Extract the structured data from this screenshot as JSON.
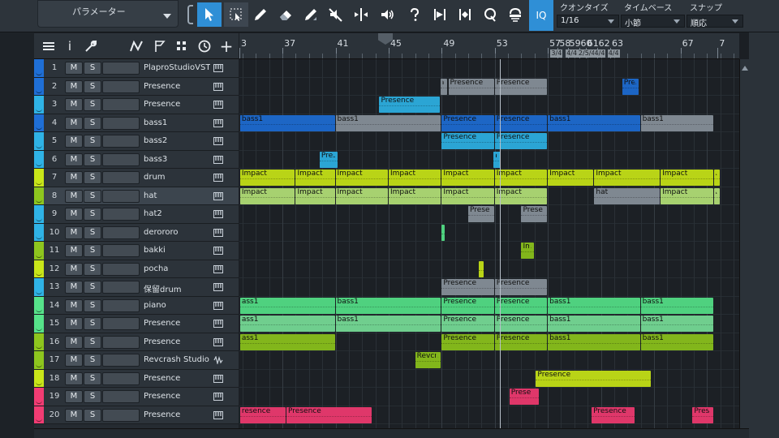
{
  "parameter_panel": {
    "label": "パラメーター"
  },
  "toolbar": {
    "iq_label": "IQ",
    "quantize": {
      "label": "クオンタイズ",
      "value": "1/16"
    },
    "timebase": {
      "label": "タイムベース",
      "value": "小節"
    },
    "snap": {
      "label": "スナップ",
      "value": "順応"
    },
    "tools": [
      "arrow-tool-icon",
      "range-tool-icon",
      "pencil-tool-icon",
      "eraser-tool-icon",
      "paint-tool-icon",
      "mute-tool-icon",
      "split-tool-icon",
      "listen-tool-icon",
      "help-icon",
      "transient-icon",
      "bend-icon",
      "quantize-q-icon",
      "groove-icon"
    ]
  },
  "track_tools": {
    "info_label": "i",
    "add_label": "+"
  },
  "button_labels": {
    "mute": "M",
    "solo": "S"
  },
  "ruler": {
    "bars": [
      "3",
      "37",
      "41",
      "45",
      "49",
      "53",
      "57",
      "58",
      "59",
      "60",
      "61",
      "62",
      "63",
      "67",
      "7"
    ],
    "time_signatures": [
      "3/4",
      "4/4",
      "2/5/4",
      "4/4",
      "4/4"
    ]
  },
  "colors": {
    "blue": "#1f6fd6",
    "cyan": "#2fb3e6",
    "lime": "#c9e619",
    "green": "#56e38a",
    "pink": "#f23c73",
    "gray": "#8a949e",
    "olive": "#8ec61e"
  },
  "tracks": [
    {
      "num": "1",
      "name": "PlaproStudioVSTi",
      "color": "#1f6fd6",
      "type": "instrument"
    },
    {
      "num": "2",
      "name": "Presence",
      "color": "#1f6fd6",
      "type": "instrument"
    },
    {
      "num": "3",
      "name": "Presence",
      "color": "#2fb3e6",
      "type": "instrument"
    },
    {
      "num": "4",
      "name": "bass1",
      "color": "#1f6fd6",
      "type": "instrument"
    },
    {
      "num": "5",
      "name": "bass2",
      "color": "#2fb3e6",
      "type": "instrument"
    },
    {
      "num": "6",
      "name": "bass3",
      "color": "#2fb3e6",
      "type": "instrument"
    },
    {
      "num": "7",
      "name": "drum",
      "color": "#c9e619",
      "type": "instrument"
    },
    {
      "num": "8",
      "name": "hat",
      "color": "#8ec61e",
      "type": "instrument",
      "selected": true
    },
    {
      "num": "9",
      "name": "hat2",
      "color": "#2fb3e6",
      "type": "instrument"
    },
    {
      "num": "10",
      "name": "derororo",
      "color": "#2fb3e6",
      "type": "instrument"
    },
    {
      "num": "11",
      "name": " bakki",
      "color": "#8ec61e",
      "type": "instrument"
    },
    {
      "num": "12",
      "name": "pocha",
      "color": "#c9e619",
      "type": "instrument"
    },
    {
      "num": "13",
      "name": "保留drum",
      "color": "#2fb3e6",
      "type": "instrument"
    },
    {
      "num": "14",
      "name": "piano",
      "color": "#56e38a",
      "type": "instrument"
    },
    {
      "num": "15",
      "name": "Presence",
      "color": "#56e38a",
      "type": "instrument"
    },
    {
      "num": "16",
      "name": "Presence",
      "color": "#8ec61e",
      "type": "instrument"
    },
    {
      "num": "17",
      "name": "Revcrash Studio",
      "color": "#8ec61e",
      "type": "audio"
    },
    {
      "num": "18",
      "name": "Presence",
      "color": "#c9e619",
      "type": "instrument"
    },
    {
      "num": "19",
      "name": "Presence",
      "color": "#f23c73",
      "type": "instrument"
    },
    {
      "num": "20",
      "name": "Presence",
      "color": "#f23c73",
      "type": "instrument"
    }
  ],
  "events": [
    {
      "track": 2,
      "start": 48.9,
      "end": 49.5,
      "label": "Pr",
      "color": "#8a949e"
    },
    {
      "track": 2,
      "start": 49.5,
      "end": 53,
      "label": "Presence",
      "color": "#8a949e"
    },
    {
      "track": 2,
      "start": 53,
      "end": 57,
      "label": "Presence",
      "color": "#8a949e"
    },
    {
      "track": 2,
      "start": 62.6,
      "end": 63.9,
      "label": "Pres",
      "color": "#1f6fd6"
    },
    {
      "track": 3,
      "start": 44.3,
      "end": 48.9,
      "label": "Presence",
      "color": "#2fb3e6"
    },
    {
      "track": 4,
      "start": 33.8,
      "end": 41,
      "label": "bass1",
      "color": "#1f6fd6"
    },
    {
      "track": 4,
      "start": 41,
      "end": 49,
      "label": "bass1",
      "color": "#8a949e"
    },
    {
      "track": 4,
      "start": 49,
      "end": 53,
      "label": "Presence",
      "color": "#1f6fd6"
    },
    {
      "track": 4,
      "start": 53,
      "end": 57,
      "label": "Presence",
      "color": "#1f6fd6"
    },
    {
      "track": 4,
      "start": 57,
      "end": 64,
      "label": "bass1",
      "color": "#1f6fd6"
    },
    {
      "track": 4,
      "start": 64,
      "end": 69.5,
      "label": "bass1",
      "color": "#8a949e"
    },
    {
      "track": 5,
      "start": 49,
      "end": 53,
      "label": "Presence",
      "color": "#2fb3e6"
    },
    {
      "track": 5,
      "start": 53,
      "end": 57,
      "label": "Presence",
      "color": "#2fb3e6"
    },
    {
      "track": 6,
      "start": 39.8,
      "end": 41.2,
      "label": "Pres",
      "color": "#2fb3e6"
    },
    {
      "track": 6,
      "start": 52.9,
      "end": 53.5,
      "label": "Pres",
      "color": "#2fb3e6"
    },
    {
      "track": 7,
      "start": 33.8,
      "end": 38,
      "label": "Impact",
      "color": "#c9e619"
    },
    {
      "track": 7,
      "start": 38,
      "end": 41,
      "label": "Impact",
      "color": "#c9e619"
    },
    {
      "track": 7,
      "start": 41,
      "end": 45,
      "label": "Impact",
      "color": "#c9e619"
    },
    {
      "track": 7,
      "start": 45,
      "end": 49,
      "label": "Impact",
      "color": "#c9e619"
    },
    {
      "track": 7,
      "start": 49,
      "end": 53,
      "label": "Impact",
      "color": "#c9e619"
    },
    {
      "track": 7,
      "start": 53,
      "end": 57,
      "label": "Impact",
      "color": "#c9e619"
    },
    {
      "track": 7,
      "start": 57,
      "end": 60.5,
      "label": "Impact",
      "color": "#c9e619"
    },
    {
      "track": 7,
      "start": 60.5,
      "end": 65.5,
      "label": "Impact",
      "color": "#c9e619"
    },
    {
      "track": 7,
      "start": 65.5,
      "end": 69.5,
      "label": "Impact",
      "color": "#c9e619"
    },
    {
      "track": 7,
      "start": 69.5,
      "end": 70,
      "label": "Im",
      "color": "#c9e619"
    },
    {
      "track": 8,
      "start": 33.8,
      "end": 38,
      "label": "Impact",
      "color": "#b5e37a"
    },
    {
      "track": 8,
      "start": 38,
      "end": 41,
      "label": "Impact",
      "color": "#b5e37a"
    },
    {
      "track": 8,
      "start": 41,
      "end": 45,
      "label": "Impact",
      "color": "#b5e37a"
    },
    {
      "track": 8,
      "start": 45,
      "end": 49,
      "label": "Impact",
      "color": "#b5e37a"
    },
    {
      "track": 8,
      "start": 49,
      "end": 53,
      "label": "Impact",
      "color": "#b5e37a"
    },
    {
      "track": 8,
      "start": 53,
      "end": 57,
      "label": "Impact",
      "color": "#b5e37a"
    },
    {
      "track": 8,
      "start": 60.5,
      "end": 65.5,
      "label": "hat",
      "color": "#8a949e"
    },
    {
      "track": 8,
      "start": 65.5,
      "end": 69.5,
      "label": "Impact",
      "color": "#b5e37a"
    },
    {
      "track": 8,
      "start": 69.5,
      "end": 70,
      "label": "Im",
      "color": "#b5e37a"
    },
    {
      "track": 9,
      "start": 51,
      "end": 53,
      "label": "Prese",
      "color": "#8a949e"
    },
    {
      "track": 9,
      "start": 55,
      "end": 57,
      "label": "Prese",
      "color": "#8a949e"
    },
    {
      "track": 10,
      "start": 49,
      "end": 49.3,
      "label": "",
      "color": "#56e38a"
    },
    {
      "track": 11,
      "start": 55,
      "end": 56,
      "label": "Im",
      "color": "#8ec61e"
    },
    {
      "track": 12,
      "start": 51.8,
      "end": 52.2,
      "label": "",
      "color": "#c9e619"
    },
    {
      "track": 13,
      "start": 49,
      "end": 53,
      "label": "Presence",
      "color": "#8a949e"
    },
    {
      "track": 13,
      "start": 53,
      "end": 57,
      "label": "Presence",
      "color": "#8a949e"
    },
    {
      "track": 14,
      "start": 33.8,
      "end": 41,
      "label": "ass1",
      "color": "#56e38a"
    },
    {
      "track": 14,
      "start": 41,
      "end": 49,
      "label": "bass1",
      "color": "#56e38a"
    },
    {
      "track": 14,
      "start": 49,
      "end": 53,
      "label": "Presence",
      "color": "#56e38a"
    },
    {
      "track": 14,
      "start": 53,
      "end": 57,
      "label": "Presence",
      "color": "#56e38a"
    },
    {
      "track": 14,
      "start": 57,
      "end": 64,
      "label": "bass1",
      "color": "#56e38a"
    },
    {
      "track": 14,
      "start": 64,
      "end": 69.5,
      "label": "bass1",
      "color": "#56e38a"
    },
    {
      "track": 15,
      "start": 33.8,
      "end": 41,
      "label": "ass1",
      "color": "#7ae09a"
    },
    {
      "track": 15,
      "start": 41,
      "end": 49,
      "label": "bass1",
      "color": "#7ae09a"
    },
    {
      "track": 15,
      "start": 49,
      "end": 53,
      "label": "Presence",
      "color": "#7ae09a"
    },
    {
      "track": 15,
      "start": 53,
      "end": 57,
      "label": "Presence",
      "color": "#7ae09a"
    },
    {
      "track": 15,
      "start": 57,
      "end": 64,
      "label": "bass1",
      "color": "#7ae09a"
    },
    {
      "track": 15,
      "start": 64,
      "end": 69.5,
      "label": "bass1",
      "color": "#7ae09a"
    },
    {
      "track": 16,
      "start": 33.8,
      "end": 41,
      "label": "ass1",
      "color": "#8ec61e"
    },
    {
      "track": 16,
      "start": 49,
      "end": 53,
      "label": "Presence",
      "color": "#8ec61e"
    },
    {
      "track": 16,
      "start": 53,
      "end": 57,
      "label": "Presence",
      "color": "#8ec61e"
    },
    {
      "track": 16,
      "start": 57,
      "end": 64,
      "label": "bass1",
      "color": "#8ec61e"
    },
    {
      "track": 16,
      "start": 64,
      "end": 69.5,
      "label": "bass1",
      "color": "#8ec61e"
    },
    {
      "track": 17,
      "start": 47,
      "end": 49,
      "label": "Revcra",
      "color": "#8ec61e"
    },
    {
      "track": 18,
      "start": 56.1,
      "end": 64.8,
      "label": "Presence",
      "color": "#c9e619"
    },
    {
      "track": 19,
      "start": 54.1,
      "end": 56.4,
      "label": "Prese",
      "color": "#f23c73"
    },
    {
      "track": 20,
      "start": 33.8,
      "end": 37.3,
      "label": "resence",
      "color": "#f23c73"
    },
    {
      "track": 20,
      "start": 37.3,
      "end": 43.8,
      "label": "Presence",
      "color": "#f23c73"
    },
    {
      "track": 20,
      "start": 60.3,
      "end": 63.6,
      "label": "Presence",
      "color": "#f23c73"
    },
    {
      "track": 20,
      "start": 67.9,
      "end": 69.5,
      "label": "Presence",
      "color": "#f23c73"
    }
  ]
}
